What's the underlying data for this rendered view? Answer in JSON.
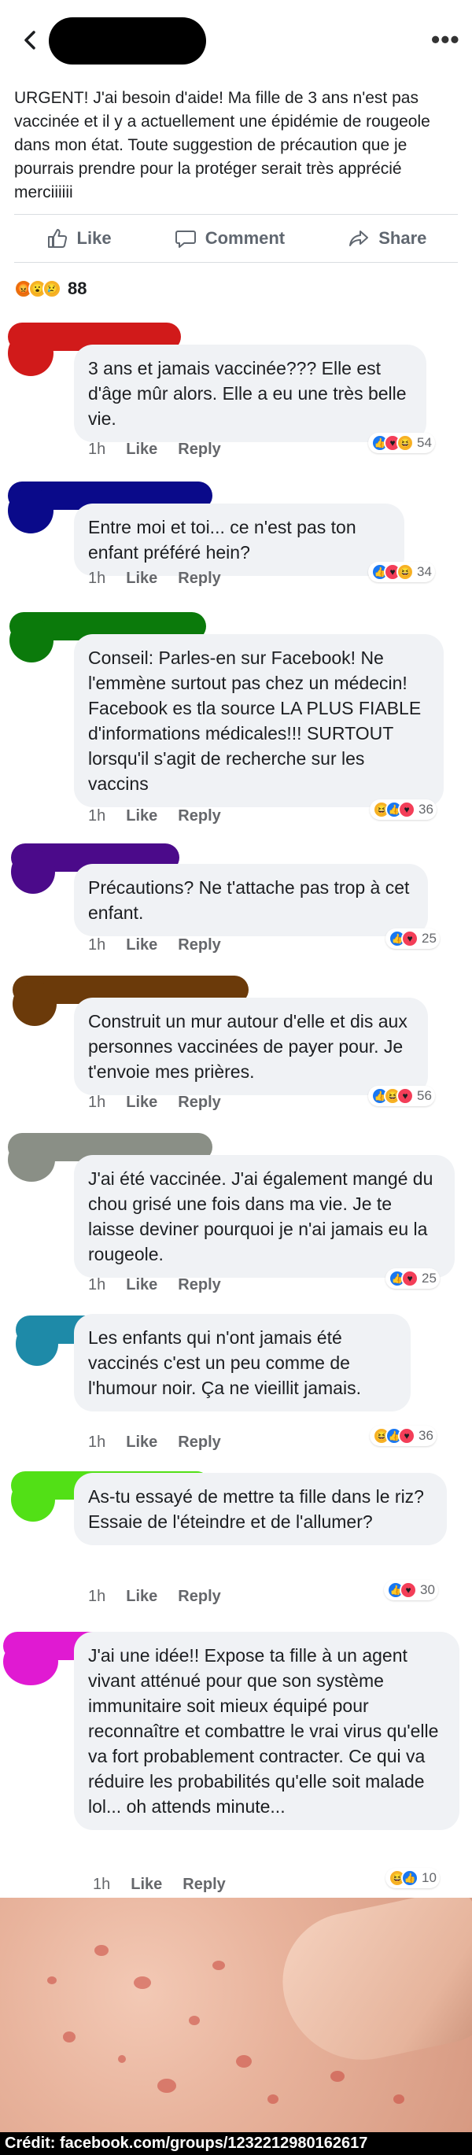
{
  "post": {
    "text": "URGENT! J'ai besoin d'aide! Ma fille de 3 ans n'est pas vaccinée et il y a actuellement une épidémie de rougeole dans mon état. Toute suggestion de précaution que je pourrais prendre pour la protéger serait très apprécié merciiiiii",
    "like_label": "Like",
    "comment_label": "Comment",
    "share_label": "Share",
    "reaction_count": "88",
    "reaction_icons": [
      "angry-icon",
      "wow-icon",
      "sad-icon"
    ]
  },
  "comments": [
    {
      "text": "3 ans et jamais vaccinée??? Elle est d'âge mûr alors. Elle a eu une très belle vie.",
      "time": "1h",
      "like": "Like",
      "reply": "Reply",
      "reactions": "54",
      "redact_color": "#d11a1a"
    },
    {
      "text": "Entre moi et toi... ce n'est pas ton enfant préféré hein?",
      "time": "1h",
      "like": "Like",
      "reply": "Reply",
      "reactions": "34",
      "redact_color": "#0a0a8a"
    },
    {
      "text": "Conseil: Parles-en sur Facebook! Ne l'emmène surtout pas chez un médecin! Facebook es tla source LA PLUS FIABLE d'informations médicales!!! SURTOUT lorsqu'il s'agit de recherche sur les vaccins",
      "time": "1h",
      "like": "Like",
      "reply": "Reply",
      "reactions": "36",
      "redact_color": "#0b7a0b"
    },
    {
      "text": "Précautions? Ne t'attache pas trop à cet enfant.",
      "time": "1h",
      "like": "Like",
      "reply": "Reply",
      "reactions": "25",
      "redact_color": "#4b0a8a"
    },
    {
      "text": "Construit un mur autour d'elle et dis aux personnes vaccinées de payer pour. Je t'envoie mes prières.",
      "time": "1h",
      "like": "Like",
      "reply": "Reply",
      "reactions": "56",
      "redact_color": "#6b3a0a"
    },
    {
      "text": "J'ai été vaccinée. J'ai également mangé du chou grisé une fois dans ma vie. Je te laisse deviner pourquoi je n'ai jamais eu la rougeole.",
      "time": "1h",
      "like": "Like",
      "reply": "Reply",
      "reactions": "25",
      "redact_color": "#8a8f86"
    },
    {
      "text": "Les enfants qui n'ont jamais été vaccinés c'est un peu comme de l'humour noir. Ça ne vieillit jamais.",
      "time": "1h",
      "like": "Like",
      "reply": "Reply",
      "reactions": "36",
      "redact_color": "#1e8aa8"
    },
    {
      "text": "As-tu essayé de mettre ta fille dans le riz? Essaie de l'éteindre et de l'allumer?",
      "time": "1h",
      "like": "Like",
      "reply": "Reply",
      "reactions": "30",
      "redact_color": "#52e016"
    },
    {
      "text": "J'ai une idée!! Expose ta fille à un agent vivant atténué pour que son système immunitaire soit mieux équipé pour reconnaître et combattre le vrai virus qu'elle va fort probablement contracter. Ce qui va réduire les probabilités qu'elle soit malade lol... oh attends minute...",
      "time": "1h",
      "like": "Like",
      "reply": "Reply",
      "reactions": "10",
      "redact_color": "#e01ad2"
    }
  ],
  "credit": "Crédit: facebook.com/groups/1232212980162617"
}
